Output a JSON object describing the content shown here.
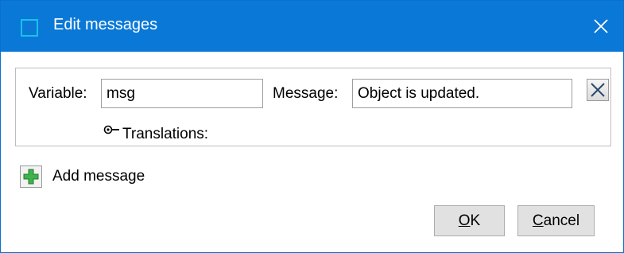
{
  "window": {
    "title": "Edit messages",
    "close_glyph": "✕",
    "icon": "window-frame-icon"
  },
  "message": {
    "variable_label": "Variable:",
    "variable_value": "msg",
    "message_label": "Message:",
    "message_value": "Object is updated.",
    "delete_icon": "delete-x-icon",
    "translations_label": "Translations:",
    "translations_icon": "expand-key-icon"
  },
  "add": {
    "label": "Add message",
    "icon": "green-plus-icon"
  },
  "buttons": {
    "ok_accel": "O",
    "ok_rest": "K",
    "cancel_accel": "C",
    "cancel_rest": "ancel"
  },
  "colors": {
    "titlebar": "#0a78d7",
    "add_icon": "#3cb44b"
  }
}
